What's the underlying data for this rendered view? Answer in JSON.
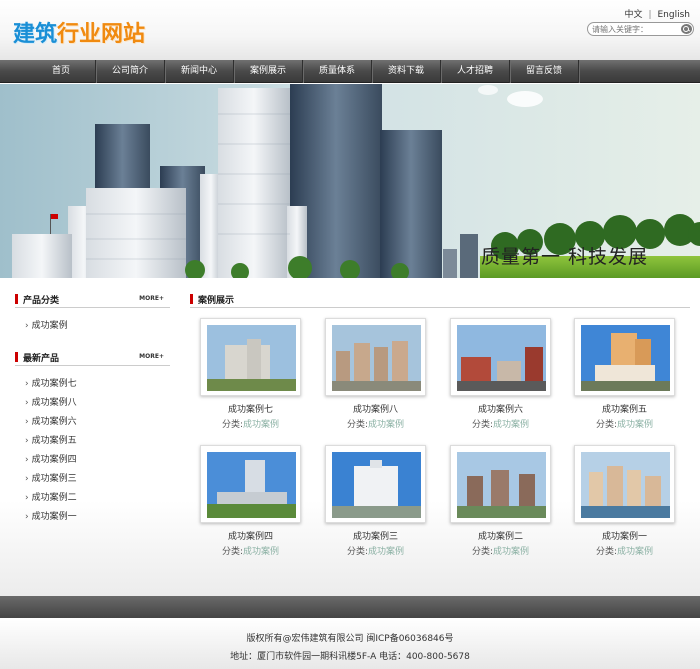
{
  "header": {
    "logo_part1": "建筑",
    "logo_part2": "行业网站",
    "lang_cn": "中文",
    "lang_sep": "|",
    "lang_en": "English",
    "search_placeholder": "请输入关键字："
  },
  "nav": [
    "首页",
    "公司简介",
    "新闻中心",
    "案例展示",
    "质量体系",
    "资料下载",
    "人才招聘",
    "留言反馈"
  ],
  "banner": {
    "slogan": "质量第一   科技发展"
  },
  "sidebar": {
    "category_title": "产品分类",
    "category_more": "MORE+",
    "categories": [
      "成功案例"
    ],
    "latest_title": "最新产品",
    "latest_more": "MORE+",
    "latest": [
      "成功案例七",
      "成功案例八",
      "成功案例六",
      "成功案例五",
      "成功案例四",
      "成功案例三",
      "成功案例二",
      "成功案例一"
    ]
  },
  "main": {
    "title": "案例展示",
    "cat_label": "分类:",
    "cases": [
      {
        "name": "成功案例七",
        "category": "成功案例"
      },
      {
        "name": "成功案例八",
        "category": "成功案例"
      },
      {
        "name": "成功案例六",
        "category": "成功案例"
      },
      {
        "name": "成功案例五",
        "category": "成功案例"
      },
      {
        "name": "成功案例四",
        "category": "成功案例"
      },
      {
        "name": "成功案例三",
        "category": "成功案例"
      },
      {
        "name": "成功案例二",
        "category": "成功案例"
      },
      {
        "name": "成功案例一",
        "category": "成功案例"
      }
    ]
  },
  "footer": {
    "line1": "版权所有@宏伟建筑有限公司  闽ICP备06036846号",
    "line2": "地址：厦门市软件园一期科讯楼5F-A 电话：400-800-5678"
  },
  "colors": {
    "logo_blue": "#1a8fd6",
    "logo_orange": "#f08a10",
    "accent_red": "#cc0000",
    "category_link": "#8ab0a3"
  }
}
